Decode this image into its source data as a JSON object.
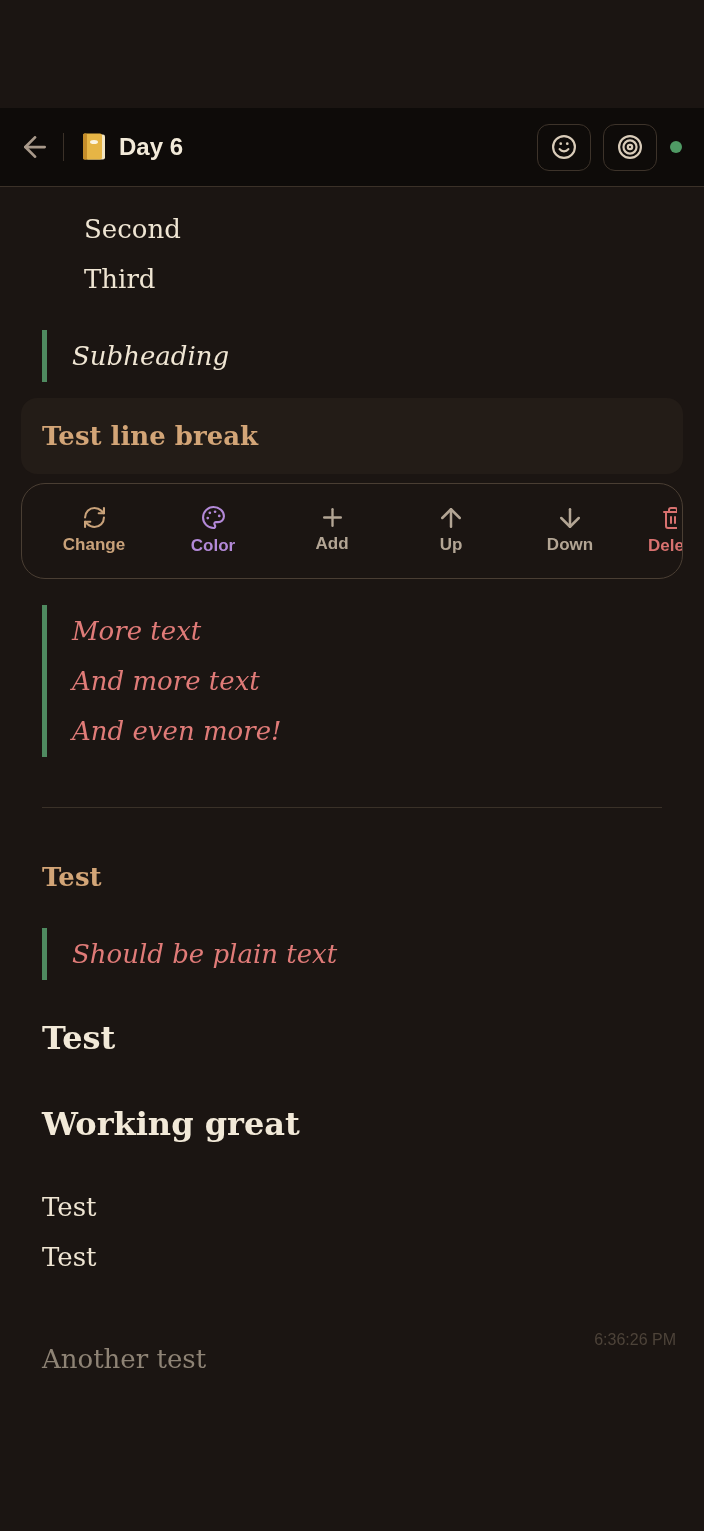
{
  "header": {
    "title": "Day 6",
    "online": true
  },
  "blocks": [
    {
      "kind": "list_item",
      "text": "Second",
      "selected": false
    },
    {
      "kind": "list_item",
      "text": "Third",
      "selected": false
    },
    {
      "kind": "quote",
      "lines": [
        "Subheading"
      ],
      "color": "#f0e6d4",
      "selected": false
    },
    {
      "kind": "heading3",
      "text": "Test line break",
      "selected": true
    },
    {
      "kind": "quote",
      "lines": [
        "More text",
        "And more text",
        "And even more!"
      ],
      "color": "#e07b78",
      "selected": false
    },
    {
      "kind": "divider",
      "selected": false
    },
    {
      "kind": "heading3",
      "text": "Test",
      "selected": false
    },
    {
      "kind": "quote",
      "lines": [
        "Should be plain text"
      ],
      "color": "#e07b78",
      "selected": false
    },
    {
      "kind": "heading2",
      "text": "Test",
      "selected": false
    },
    {
      "kind": "heading2",
      "text": "Working great",
      "selected": false
    },
    {
      "kind": "paragraph",
      "text": "Test",
      "selected": false
    },
    {
      "kind": "paragraph",
      "text": "Test",
      "selected": false
    }
  ],
  "block_actions": [
    {
      "kind": "change",
      "label": "Change",
      "color": "#c9a27a"
    },
    {
      "kind": "color",
      "label": "Color",
      "color": "#b389d8"
    },
    {
      "kind": "add",
      "label": "Add",
      "color": "#b3a594"
    },
    {
      "kind": "up",
      "label": "Up",
      "color": "#b3a594"
    },
    {
      "kind": "down",
      "label": "Down",
      "color": "#b3a594"
    },
    {
      "kind": "delete",
      "label": "Dele",
      "color": "#d8716f"
    }
  ],
  "pending_entry": {
    "text": "Another test",
    "timestamp": "6:36:26 PM"
  }
}
